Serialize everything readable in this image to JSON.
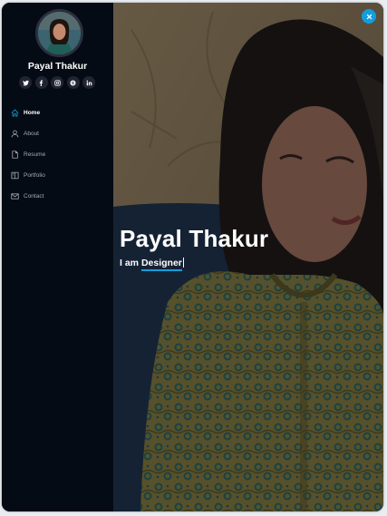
{
  "profile": {
    "name": "Payal Thakur",
    "avatar_icon": "user-photo"
  },
  "socials": [
    {
      "icon": "twitter-icon"
    },
    {
      "icon": "facebook-icon"
    },
    {
      "icon": "instagram-icon"
    },
    {
      "icon": "skype-icon"
    },
    {
      "icon": "linkedin-icon"
    }
  ],
  "nav": {
    "items": [
      {
        "label": "Home",
        "icon": "home-icon",
        "active": true
      },
      {
        "label": "About",
        "icon": "user-icon",
        "active": false
      },
      {
        "label": "Resume",
        "icon": "file-icon",
        "active": false
      },
      {
        "label": "Portfolio",
        "icon": "book-icon",
        "active": false
      },
      {
        "label": "Contact",
        "icon": "envelope-icon",
        "active": false
      }
    ]
  },
  "hero": {
    "title": "Payal Thakur",
    "prefix": "I am",
    "typed": "Designer"
  },
  "toggle": {
    "icon": "close-icon"
  },
  "colors": {
    "sidebar_bg": "#040b14",
    "accent": "#149ddd",
    "nav_text": "#a8a9b4",
    "social_bg": "#212431"
  }
}
